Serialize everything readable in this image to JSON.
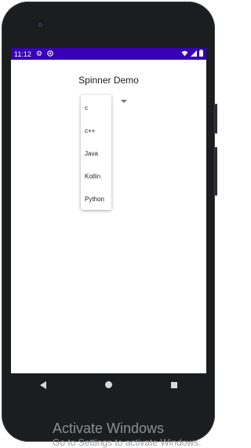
{
  "status_bar": {
    "time": "11:12",
    "left_icons": [
      "gear-icon",
      "circle-a-icon"
    ],
    "right_icons": [
      "wifi-icon",
      "signal-icon",
      "battery-icon"
    ],
    "color": "#3700b3"
  },
  "app": {
    "title": "Spinner Demo"
  },
  "spinner": {
    "options": [
      "c",
      "c++",
      "Java",
      "Kotlin",
      "Python"
    ]
  },
  "nav_bar": {
    "buttons": [
      "back-icon",
      "home-icon",
      "recents-icon"
    ]
  },
  "watermark": {
    "title": "Activate Windows",
    "subtitle": "Go to Settings to activate Windows."
  }
}
